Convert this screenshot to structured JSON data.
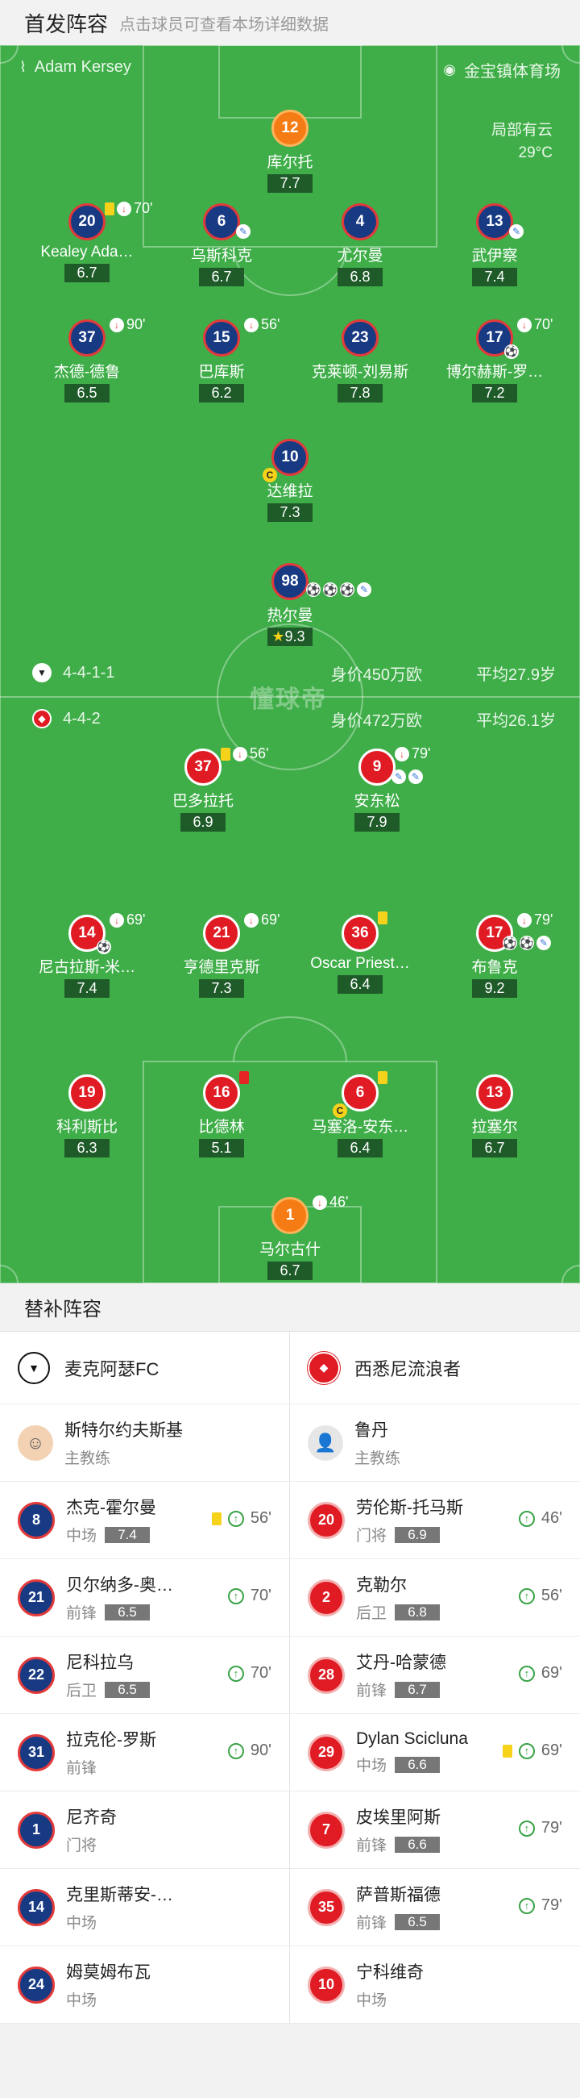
{
  "header": {
    "title": "首发阵容",
    "subtitle": "点击球员可查看本场详细数据"
  },
  "pitch": {
    "referee": "Adam Kersey",
    "stadium": "金宝镇体育场",
    "weather": "局部有云",
    "temperature": "29°C",
    "watermark": "懂球帝"
  },
  "home_team": {
    "formation": "4-4-1-1",
    "value": "身价450万欧",
    "avg_age": "平均27.9岁",
    "color": "#173a83"
  },
  "away_team": {
    "formation": "4-4-2",
    "value": "身价472万欧",
    "avg_age": "平均26.1岁",
    "color": "#e01b24"
  },
  "home_players": [
    {
      "num": "12",
      "name": "库尔托",
      "rating": "7.7"
    },
    {
      "num": "20",
      "name": "Kealey Ada…",
      "rating": "6.7",
      "sub_min": "70'"
    },
    {
      "num": "6",
      "name": "乌斯科克",
      "rating": "6.7"
    },
    {
      "num": "4",
      "name": "尤尔曼",
      "rating": "6.8"
    },
    {
      "num": "13",
      "name": "武伊察",
      "rating": "7.4"
    },
    {
      "num": "37",
      "name": "杰德-德鲁",
      "rating": "6.5",
      "sub_min": "90'"
    },
    {
      "num": "15",
      "name": "巴库斯",
      "rating": "6.2",
      "sub_min": "56'"
    },
    {
      "num": "23",
      "name": "克莱顿-刘易斯",
      "rating": "7.8"
    },
    {
      "num": "17",
      "name": "博尔赫斯-罗…",
      "rating": "7.2",
      "sub_min": "70'"
    },
    {
      "num": "10",
      "name": "达维拉",
      "rating": "7.3"
    },
    {
      "num": "98",
      "name": "热尔曼",
      "rating": "9.3"
    }
  ],
  "away_players": [
    {
      "num": "37",
      "name": "巴多拉托",
      "rating": "6.9",
      "sub_min": "56'"
    },
    {
      "num": "9",
      "name": "安东松",
      "rating": "7.9",
      "sub_min": "79'"
    },
    {
      "num": "14",
      "name": "尼古拉斯-米…",
      "rating": "7.4",
      "sub_min": "69'"
    },
    {
      "num": "21",
      "name": "亨德里克斯",
      "rating": "7.3",
      "sub_min": "69'"
    },
    {
      "num": "36",
      "name": "Oscar Priest…",
      "rating": "6.4"
    },
    {
      "num": "17",
      "name": "布鲁克",
      "rating": "9.2",
      "sub_min": "79'"
    },
    {
      "num": "19",
      "name": "科利斯比",
      "rating": "6.3"
    },
    {
      "num": "16",
      "name": "比德林",
      "rating": "5.1"
    },
    {
      "num": "6",
      "name": "马塞洛-安东…",
      "rating": "6.4"
    },
    {
      "num": "13",
      "name": "拉塞尔",
      "rating": "6.7"
    },
    {
      "num": "1",
      "name": "马尔古什",
      "rating": "6.7",
      "sub_min": "46'"
    }
  ],
  "subs": {
    "title": "替补阵容",
    "home_team_name": "麦克阿瑟FC",
    "away_team_name": "西悉尼流浪者",
    "home_coach": {
      "name": "斯特尔约夫斯基",
      "role": "主教练"
    },
    "away_coach": {
      "name": "鲁丹",
      "role": "主教练"
    },
    "home": [
      {
        "num": "8",
        "name": "杰克-霍尔曼",
        "pos": "中场",
        "rating": "7.4",
        "min": "56'"
      },
      {
        "num": "21",
        "name": "贝尔纳多-奥…",
        "pos": "前锋",
        "rating": "6.5",
        "min": "70'"
      },
      {
        "num": "22",
        "name": "尼科拉乌",
        "pos": "后卫",
        "rating": "6.5",
        "min": "70'"
      },
      {
        "num": "31",
        "name": "拉克伦-罗斯",
        "pos": "前锋",
        "rating": "",
        "min": "90'"
      },
      {
        "num": "1",
        "name": "尼齐奇",
        "pos": "门将",
        "rating": "",
        "min": ""
      },
      {
        "num": "14",
        "name": "克里斯蒂安-…",
        "pos": "中场",
        "rating": "",
        "min": ""
      },
      {
        "num": "24",
        "name": "姆莫姆布瓦",
        "pos": "中场",
        "rating": "",
        "min": ""
      }
    ],
    "away": [
      {
        "num": "20",
        "name": "劳伦斯-托马斯",
        "pos": "门将",
        "rating": "6.9",
        "min": "46'"
      },
      {
        "num": "2",
        "name": "克勒尔",
        "pos": "后卫",
        "rating": "6.8",
        "min": "56'"
      },
      {
        "num": "28",
        "name": "艾丹-哈蒙德",
        "pos": "前锋",
        "rating": "6.7",
        "min": "69'"
      },
      {
        "num": "29",
        "name": "Dylan Scicluna",
        "pos": "中场",
        "rating": "6.6",
        "min": "69'"
      },
      {
        "num": "7",
        "name": "皮埃里阿斯",
        "pos": "前锋",
        "rating": "6.6",
        "min": "79'"
      },
      {
        "num": "35",
        "name": "萨普斯福德",
        "pos": "前锋",
        "rating": "6.5",
        "min": "79'"
      },
      {
        "num": "10",
        "name": "宁科维奇",
        "pos": "中场",
        "rating": "",
        "min": ""
      }
    ]
  }
}
